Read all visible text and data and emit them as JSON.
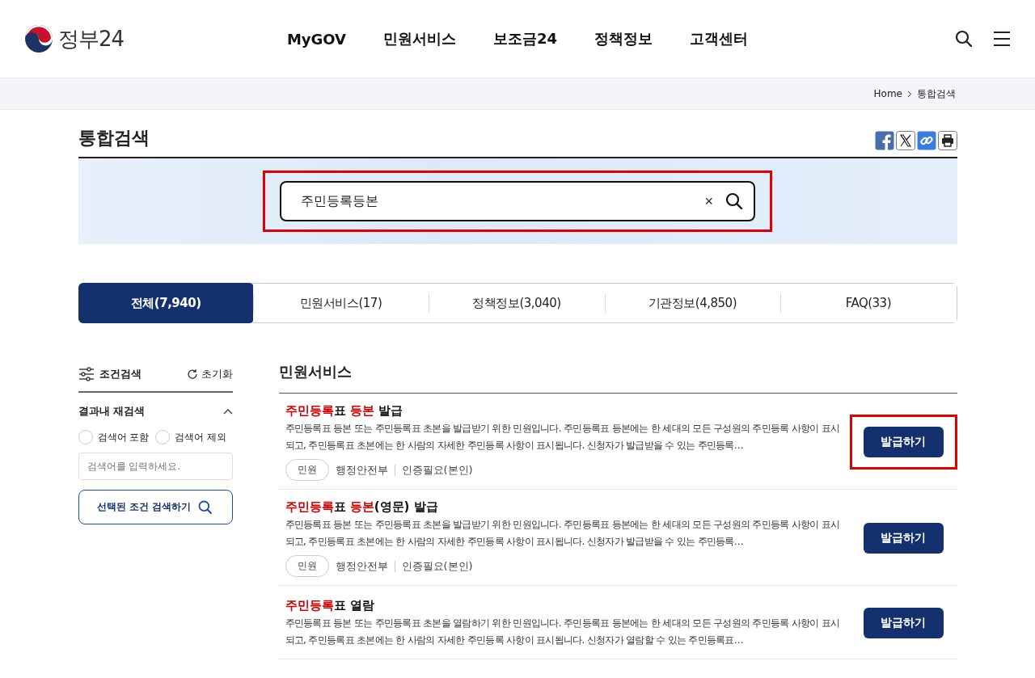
{
  "header": {
    "logo_text": "정부24",
    "nav": [
      "MyGOV",
      "민원서비스",
      "보조금24",
      "정책정보",
      "고객센터"
    ]
  },
  "breadcrumb": [
    "Home",
    "통합검색"
  ],
  "page_title": "통합검색",
  "search": {
    "value": "주민등록등본",
    "clear_label": "×",
    "highlighted": true
  },
  "tabs": [
    {
      "label": "전체(7,940)",
      "selected": true
    },
    {
      "label": "민원서비스(17)",
      "selected": false
    },
    {
      "label": "정책정보(3,040)",
      "selected": false
    },
    {
      "label": "기관정보(4,850)",
      "selected": false
    },
    {
      "label": "FAQ(33)",
      "selected": false
    }
  ],
  "sidebar": {
    "title": "조건검색",
    "reset": "초기화",
    "section": "결과내 재검색",
    "expanded": true,
    "options": [
      {
        "label": "검색어 포함",
        "selected": false
      },
      {
        "label": "검색어 제외",
        "selected": false
      }
    ],
    "placeholder": "검색어를 입력하세요.",
    "submit": "선택된 조건 검색하기"
  },
  "results_heading": "민원서비스",
  "results": [
    {
      "title": [
        {
          "text": "주민등록",
          "match": true
        },
        {
          "text": "표 ",
          "match": false
        },
        {
          "text": "등본",
          "match": true
        },
        {
          "text": " 발급",
          "match": false
        }
      ],
      "description": "주민등록표 등본 또는 주민등록표 초본을 발급받기 위한 민원입니다. 주민등록표 등본에는 한 세대의 모든 구성원의 주민등록 사항이 표시되고, 주민등록표 초본에는 한 사람의 자세한 주민등록 사항이 표시됩니다. 신청자가 발급받을 수 있는 주민등록…",
      "tag": "민원",
      "agency": "행정안전부",
      "auth": "인증필요(본인)",
      "button": "발급하기",
      "highlighted": true
    },
    {
      "title": [
        {
          "text": "주민등록",
          "match": true
        },
        {
          "text": "표 ",
          "match": false
        },
        {
          "text": "등본",
          "match": true
        },
        {
          "text": "(영문) 발급",
          "match": false
        }
      ],
      "description": "주민등록표 등본 또는 주민등록표 초본을 발급받기 위한 민원입니다. 주민등록표 등본에는 한 세대의 모든 구성원의 주민등록 사항이 표시되고, 주민등록표 초본에는 한 사람의 자세한 주민등록 사항이 표시됩니다. 신청자가 발급받을 수 있는 주민등록…",
      "tag": "민원",
      "agency": "행정안전부",
      "auth": "인증필요(본인)",
      "button": "발급하기",
      "highlighted": false
    },
    {
      "title": [
        {
          "text": "주민등록",
          "match": true
        },
        {
          "text": "표 열람",
          "match": false
        }
      ],
      "description": "주민등록표 등본 또는 주민등록표 초본을 열람하기 위한 민원입니다. 주민등록표 등본에는 한 세대의 모든 구성원의 주민등록 사항이 표시되고, 주민등록표 초본에는 한 사람의 자세한 주민등록 사항이 표시됩니다. 신청자가 열람할 수 있는 주민등록표…",
      "button": "발급하기",
      "highlighted": false
    }
  ]
}
